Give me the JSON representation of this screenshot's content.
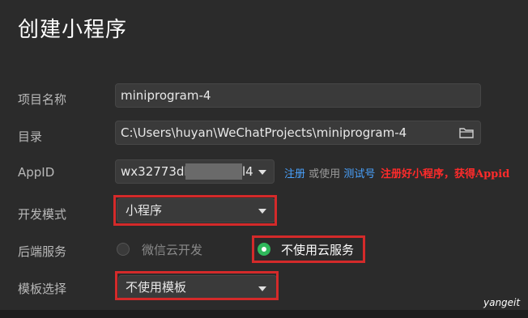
{
  "header": {
    "title": "创建小程序"
  },
  "form": {
    "project_name": {
      "label": "项目名称",
      "value": "miniprogram-4"
    },
    "directory": {
      "label": "目录",
      "value": "C:\\Users\\huyan\\WeChatProjects\\miniprogram-4",
      "icon": "folder-icon"
    },
    "appid": {
      "label": "AppID",
      "value_prefix": "wx32773db",
      "value_suffix": "l4",
      "register_link": "注册",
      "or_use": "或使用",
      "test_link": "测试号",
      "annotation": "注册好小程序，获得Appid"
    },
    "dev_mode": {
      "label": "开发模式",
      "selected": "小程序"
    },
    "backend": {
      "label": "后端服务",
      "options": [
        {
          "label": "微信云开发",
          "checked": false
        },
        {
          "label": "不使用云服务",
          "checked": true
        }
      ]
    },
    "template": {
      "label": "模板选择",
      "selected": "不使用模板"
    }
  },
  "colors": {
    "background": "#2b2b2b",
    "link": "#4aa3ff",
    "highlight": "#d42a2a",
    "radio_on": "#2fb85b"
  },
  "watermark": "yangeit"
}
